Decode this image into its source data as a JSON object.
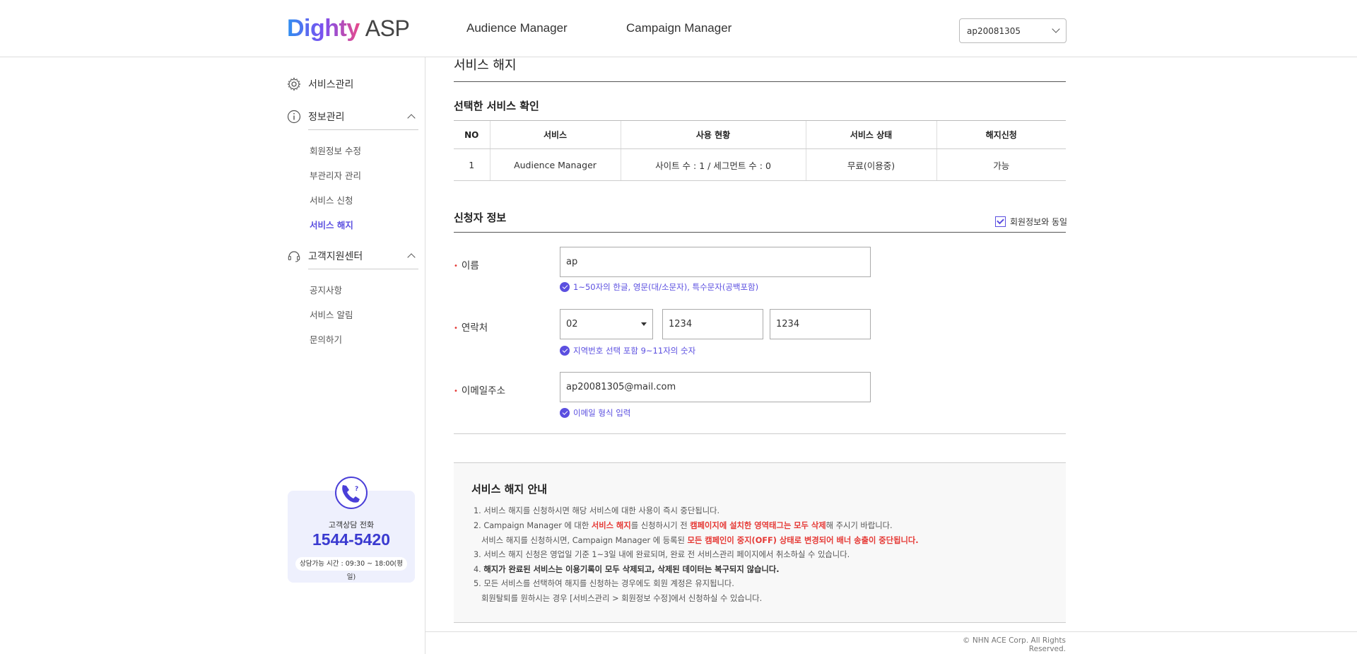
{
  "header": {
    "logo_dighty": "Dighty",
    "logo_asp": "ASP",
    "nav": [
      "Audience Manager",
      "Campaign Manager"
    ],
    "account_select": "ap20081305"
  },
  "sidebar": {
    "service_mgmt": "서비스관리",
    "info_mgmt": "정보관리",
    "info_items": [
      "회원정보 수정",
      "부관리자 관리",
      "서비스 신청",
      "서비스 해지"
    ],
    "cs_center": "고객지원센터",
    "cs_items": [
      "공지사항",
      "서비스 알림",
      "문의하기"
    ],
    "cs_box": {
      "label": "고객상담 전화",
      "number": "1544-5420",
      "hours": "상담가능 시간 : 09:30 ~ 18:00(평일)"
    }
  },
  "main": {
    "page_title": "서비스 해지",
    "selected_title": "선택한 서비스 확인",
    "table": {
      "headers": [
        "NO",
        "서비스",
        "사용 현황",
        "서비스 상태",
        "해지신청"
      ],
      "rows": [
        [
          "1",
          "Audience Manager",
          "사이트 수 : 1 / 세그먼트 수 : 0",
          "무료(이용중)",
          "가능"
        ]
      ]
    },
    "applicant_title": "신청자 정보",
    "same_as_member": "회원정보와 동일",
    "required_mark": "•",
    "name_label": "이름",
    "name_value": "ap",
    "name_hint": "1~50자의 한글, 영문(대/소문자), 특수문자(공백포함)",
    "phone_label": "연락처",
    "phone_area": "02",
    "phone_mid": "1234",
    "phone_last": "1234",
    "phone_hint": "지역번호 선택 포함 9~11자의 숫자",
    "email_label": "이메일주소",
    "email_value": "ap20081305@mail.com",
    "email_hint": "이메일 형식 입력"
  },
  "notice": {
    "title": "서비스 해지 안내",
    "l1": "1. 서비스 해지를 신청하시면 해당 서비스에 대한 사용이 즉시 중단됩니다.",
    "l2a": "2. Campaign Manager 에 대한 ",
    "l2b": "서비스 해지",
    "l2c": "를 신청하시기 전 ",
    "l2d": "캠페이지에 설치한 영역태그는 모두 삭제",
    "l2e": "해 주시기 바랍니다.",
    "l2f": "서비스 해지를 신청하시면, Campaign Manager 에 등록된 ",
    "l2g": "모든 캠페인이 중지(OFF) 상태로 변경되어 배너 송출이 중단됩니다.",
    "l3": "3. 서비스 해지 신청은 영업일 기준 1~3일 내에 완료되며, 완료 전 서비스관리 페이지에서 취소하실 수 있습니다.",
    "l4a": "4. ",
    "l4b": "해지가 완료된 서비스는 이용기록이 모두 삭제되고, 삭제된 데이터는 복구되지 않습니다.",
    "l5": "5. 모든 서비스를 선택하여 해지를 신청하는 경우에도 회원 계정은 유지됩니다.",
    "l5b": "회원탈퇴를 원하시는 경우 [서비스관리 > 회원정보 수정]에서 신청하실 수 있습니다."
  },
  "footer": {
    "copyright": "© NHN ACE Corp. All Rights Reserved."
  }
}
